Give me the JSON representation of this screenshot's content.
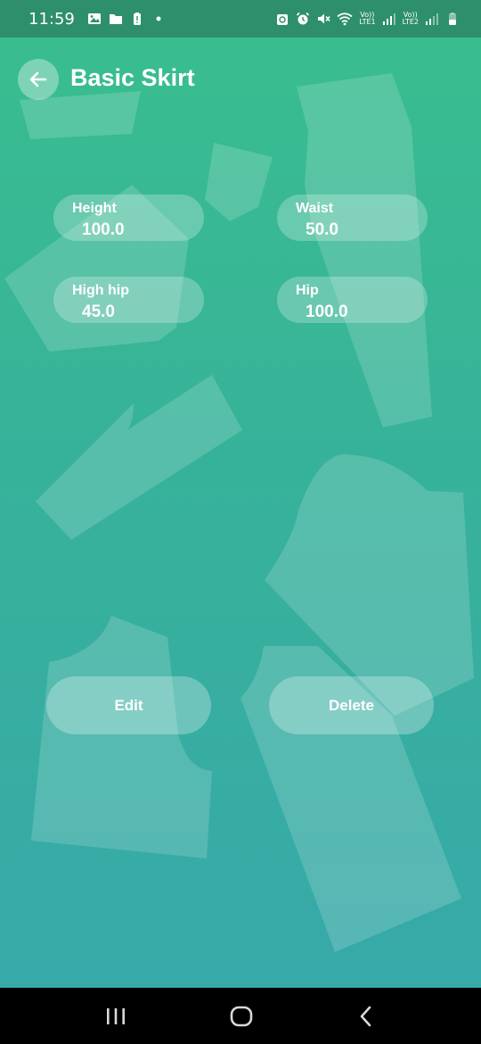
{
  "status_bar": {
    "time": "11:59",
    "sim1_label": "LTE1",
    "sim2_label": "LTE2",
    "volte_label": "Vo))"
  },
  "header": {
    "title": "Basic Skirt"
  },
  "measurements": [
    {
      "label": "Height",
      "value": "100.0"
    },
    {
      "label": "Waist",
      "value": "50.0"
    },
    {
      "label": "High hip",
      "value": "45.0"
    },
    {
      "label": "Hip",
      "value": "100.0"
    }
  ],
  "actions": {
    "edit_label": "Edit",
    "delete_label": "Delete"
  },
  "colors": {
    "gradient_top": "#39bd8f",
    "gradient_bottom": "#37a9a9",
    "status_bar": "#2e8f6c"
  }
}
